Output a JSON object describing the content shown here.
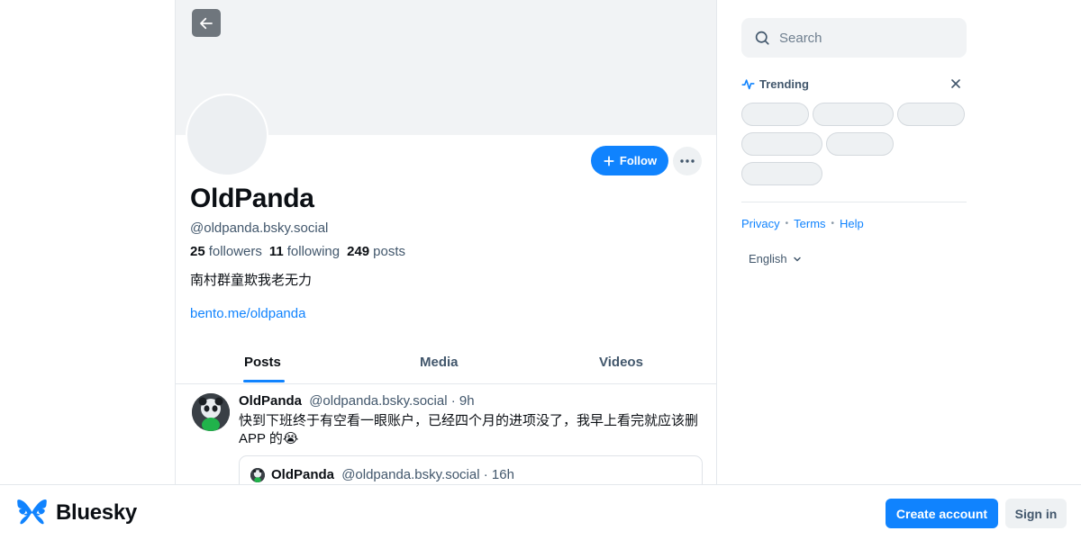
{
  "profile": {
    "display_name": "OldPanda",
    "handle": "@oldpanda.bsky.social",
    "followers_count": "25",
    "followers_label": "followers",
    "following_count": "11",
    "following_label": "following",
    "posts_count": "249",
    "posts_label": "posts",
    "bio": "南村群童欺我老无力",
    "link": "bento.me/oldpanda",
    "follow_label": "Follow"
  },
  "tabs": [
    {
      "label": "Posts",
      "active": true
    },
    {
      "label": "Media",
      "active": false
    },
    {
      "label": "Videos",
      "active": false
    }
  ],
  "post": {
    "author": "OldPanda",
    "handle": "@oldpanda.bsky.social",
    "time": "· 9h",
    "text": "快到下班终于有空看一眼账户，已经四个月的进项没了，我早上看完就应该删APP 的😭",
    "quote": {
      "author": "OldPanda",
      "handle": "@oldpanda.bsky.social",
      "time": "· 16h"
    }
  },
  "sidebar": {
    "search_placeholder": "Search",
    "trending_title": "Trending",
    "footer_links": [
      "Privacy",
      "Terms",
      "Help"
    ],
    "language": "English"
  },
  "bottom_bar": {
    "brand": "Bluesky",
    "create_account": "Create account",
    "sign_in": "Sign in"
  },
  "colors": {
    "accent": "#1083fe",
    "muted_text": "#42576c",
    "banner": "#f1f3f5"
  }
}
